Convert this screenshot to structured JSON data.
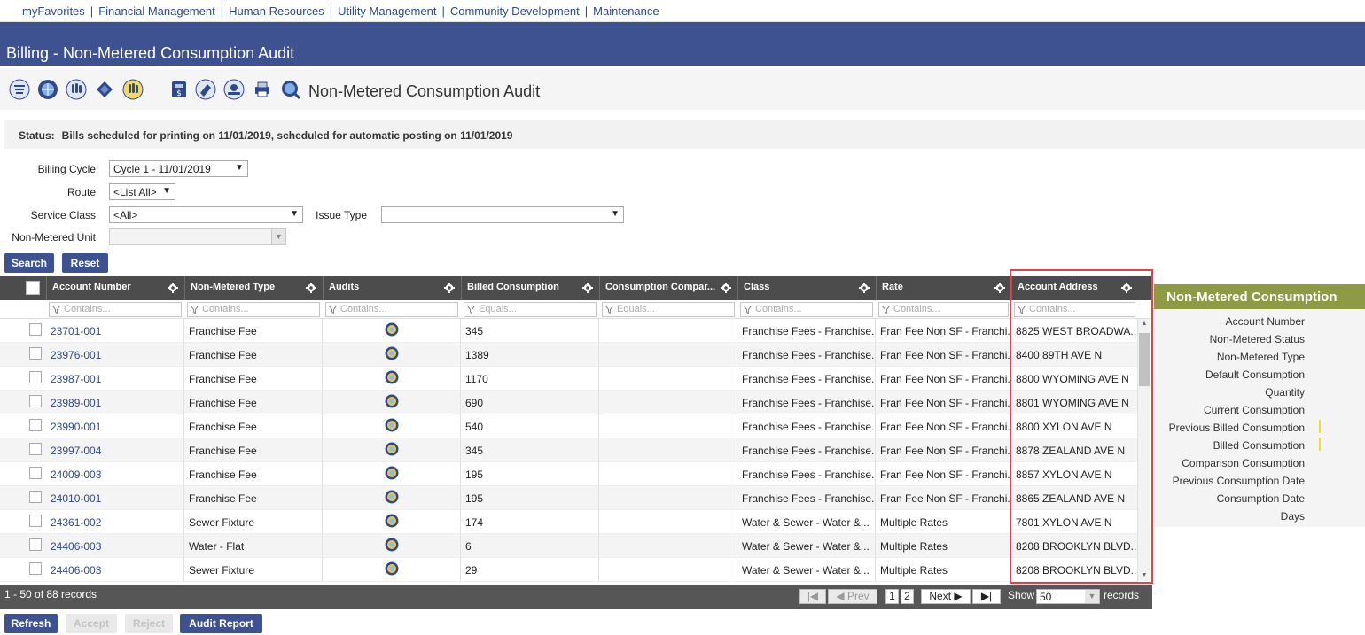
{
  "nav": {
    "items": [
      "myFavorites",
      "Financial Management",
      "Human Resources",
      "Utility Management",
      "Community Development",
      "Maintenance"
    ],
    "sep": "|"
  },
  "title": "Billing - Non-Metered Consumption Audit",
  "toolbar": {
    "title": "Non-Metered Consumption Audit",
    "icons": [
      "list-icon",
      "globe-icon",
      "hand-icon",
      "map-icon",
      "hand-wave-icon",
      "calculator-icon",
      "stamp-icon",
      "hand-coin-icon",
      "printer-icon",
      "globe-search-icon"
    ]
  },
  "status": {
    "label": "Status:",
    "text": "Bills scheduled for printing on 11/01/2019, scheduled for automatic posting on 11/01/2019"
  },
  "filters": {
    "billing_cycle_label": "Billing Cycle",
    "billing_cycle_value": "Cycle 1 - 11/01/2019",
    "route_label": "Route",
    "route_value": "<List All>",
    "service_class_label": "Service Class",
    "service_class_value": "<All>",
    "issue_type_label": "Issue Type",
    "issue_type_value": "",
    "unit_label": "Non-Metered Unit",
    "unit_value": ""
  },
  "buttons": {
    "search": "Search",
    "reset": "Reset",
    "refresh": "Refresh",
    "accept": "Accept",
    "reject": "Reject",
    "audit_report": "Audit Report"
  },
  "grid": {
    "columns": [
      {
        "label": "Account Number",
        "filter": "Contains..."
      },
      {
        "label": "Non-Metered Type",
        "filter": "Contains..."
      },
      {
        "label": "Audits",
        "filter": "Contains..."
      },
      {
        "label": "Billed Consumption",
        "filter": "Equals..."
      },
      {
        "label": "Consumption Compar...",
        "filter": "Equals..."
      },
      {
        "label": "Class",
        "filter": "Contains..."
      },
      {
        "label": "Rate",
        "filter": "Contains..."
      },
      {
        "label": "Account Address",
        "filter": "Contains..."
      }
    ],
    "rows": [
      {
        "acct": "23701-001",
        "type": "Franchise Fee",
        "billed": "345",
        "comp": "",
        "cls": "Franchise Fees - Franchise...",
        "rate": "Fran Fee Non SF - Franchi...",
        "addr": "8825 WEST BROADWA..."
      },
      {
        "acct": "23976-001",
        "type": "Franchise Fee",
        "billed": "1389",
        "comp": "",
        "cls": "Franchise Fees - Franchise...",
        "rate": "Fran Fee Non SF - Franchi...",
        "addr": "8400 89TH AVE N"
      },
      {
        "acct": "23987-001",
        "type": "Franchise Fee",
        "billed": "1170",
        "comp": "",
        "cls": "Franchise Fees - Franchise...",
        "rate": "Fran Fee Non SF - Franchi...",
        "addr": "8800 WYOMING AVE N"
      },
      {
        "acct": "23989-001",
        "type": "Franchise Fee",
        "billed": "690",
        "comp": "",
        "cls": "Franchise Fees - Franchise...",
        "rate": "Fran Fee Non SF - Franchi...",
        "addr": "8801 WYOMING AVE N"
      },
      {
        "acct": "23990-001",
        "type": "Franchise Fee",
        "billed": "540",
        "comp": "",
        "cls": "Franchise Fees - Franchise...",
        "rate": "Fran Fee Non SF - Franchi...",
        "addr": "8800 XYLON AVE N"
      },
      {
        "acct": "23997-004",
        "type": "Franchise Fee",
        "billed": "345",
        "comp": "",
        "cls": "Franchise Fees - Franchise...",
        "rate": "Fran Fee Non SF - Franchi...",
        "addr": "8878 ZEALAND AVE N"
      },
      {
        "acct": "24009-003",
        "type": "Franchise Fee",
        "billed": "195",
        "comp": "",
        "cls": "Franchise Fees - Franchise...",
        "rate": "Fran Fee Non SF - Franchi...",
        "addr": "8857 XYLON AVE N"
      },
      {
        "acct": "24010-001",
        "type": "Franchise Fee",
        "billed": "195",
        "comp": "",
        "cls": "Franchise Fees - Franchise...",
        "rate": "Fran Fee Non SF - Franchi...",
        "addr": "8865 ZEALAND AVE N"
      },
      {
        "acct": "24361-002",
        "type": "Sewer Fixture",
        "billed": "174",
        "comp": "",
        "cls": "Water & Sewer - Water &...",
        "rate": "Multiple Rates",
        "addr": "7801 XYLON AVE N"
      },
      {
        "acct": "24406-003",
        "type": "Water - Flat",
        "billed": "6",
        "comp": "",
        "cls": "Water & Sewer - Water &...",
        "rate": "Multiple Rates",
        "addr": "8208 BROOKLYN BLVD..."
      },
      {
        "acct": "24406-003",
        "type": "Sewer Fixture",
        "billed": "29",
        "comp": "",
        "cls": "Water & Sewer - Water &...",
        "rate": "Multiple Rates",
        "addr": "8208 BROOKLYN BLVD..."
      }
    ],
    "footer": {
      "count": "1 - 50 of 88 records",
      "prev": "Prev",
      "pages": [
        "1",
        "2"
      ],
      "next": "Next",
      "show_label": "Show",
      "show_value": "50",
      "records_label": "records"
    }
  },
  "panel": {
    "title": "Non-Metered Consumption",
    "items": [
      "Account Number",
      "Non-Metered Status",
      "Non-Metered Type",
      "Default Consumption",
      "Quantity",
      "Current Consumption",
      "Previous Billed Consumption",
      "Billed Consumption",
      "Comparison Consumption",
      "Previous Consumption Date",
      "Consumption Date",
      "Days"
    ]
  },
  "colors": {
    "header_blue": "#3e5291",
    "grid_header": "#4c4c4c",
    "panel_green": "#8f9a44",
    "highlight_red": "#e0434b"
  }
}
